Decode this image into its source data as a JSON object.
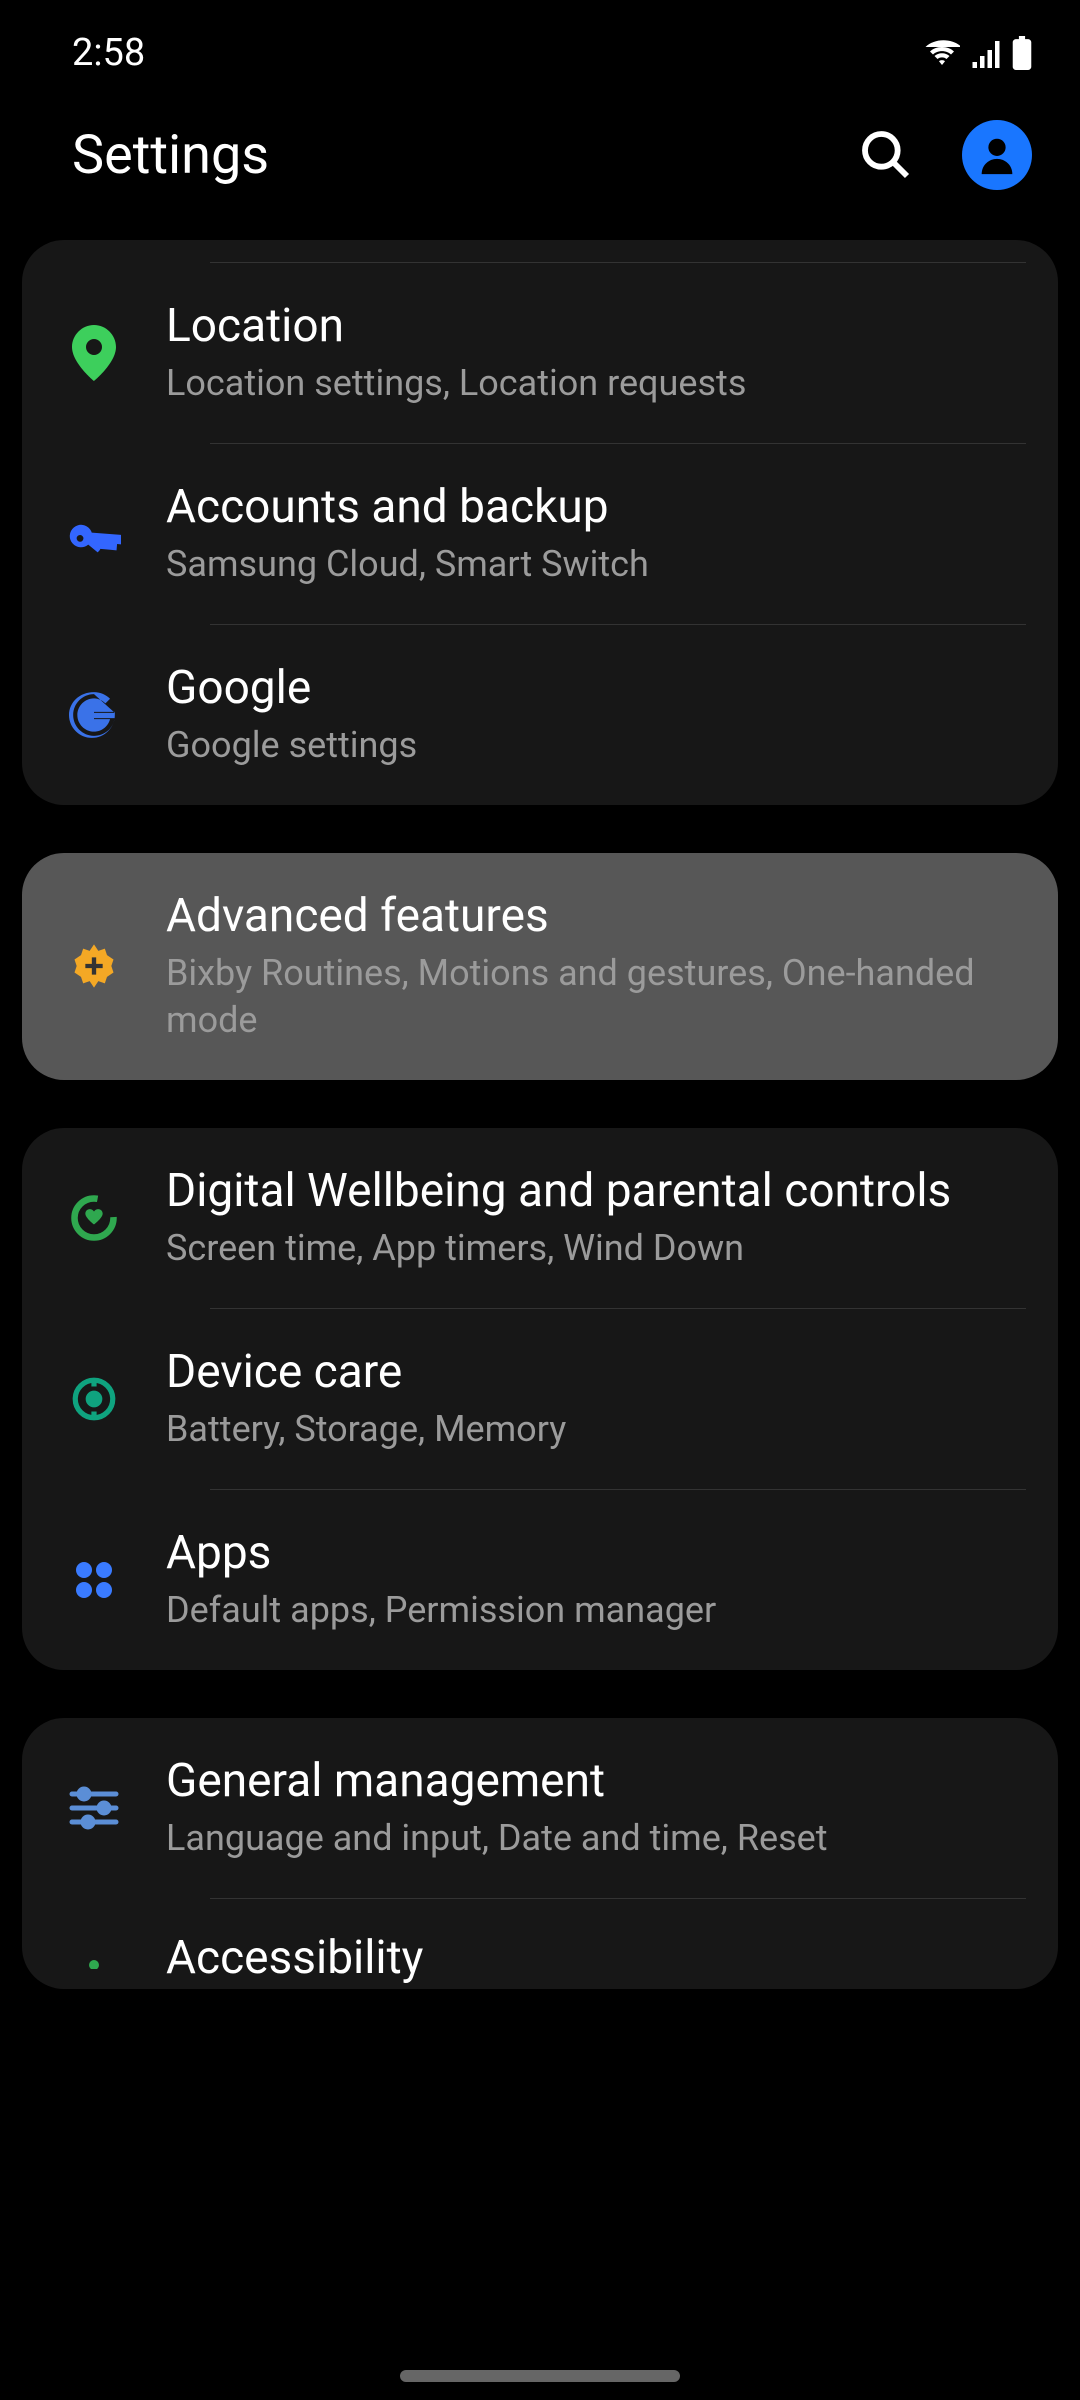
{
  "status": {
    "time": "2:58"
  },
  "header": {
    "title": "Settings"
  },
  "groups": [
    {
      "items": [
        {
          "title": "Location",
          "subtitle": "Location settings, Location requests"
        },
        {
          "title": "Accounts and backup",
          "subtitle": "Samsung Cloud, Smart Switch"
        },
        {
          "title": "Google",
          "subtitle": "Google settings"
        }
      ]
    },
    {
      "items": [
        {
          "title": "Advanced features",
          "subtitle": "Bixby Routines, Motions and gestures, One-handed mode"
        }
      ]
    },
    {
      "items": [
        {
          "title": "Digital Wellbeing and parental controls",
          "subtitle": "Screen time, App timers, Wind Down"
        },
        {
          "title": "Device care",
          "subtitle": "Battery, Storage, Memory"
        },
        {
          "title": "Apps",
          "subtitle": "Default apps, Permission manager"
        }
      ]
    },
    {
      "items": [
        {
          "title": "General management",
          "subtitle": "Language and input, Date and time, Reset"
        },
        {
          "title": "Accessibility",
          "subtitle": ""
        }
      ]
    }
  ]
}
